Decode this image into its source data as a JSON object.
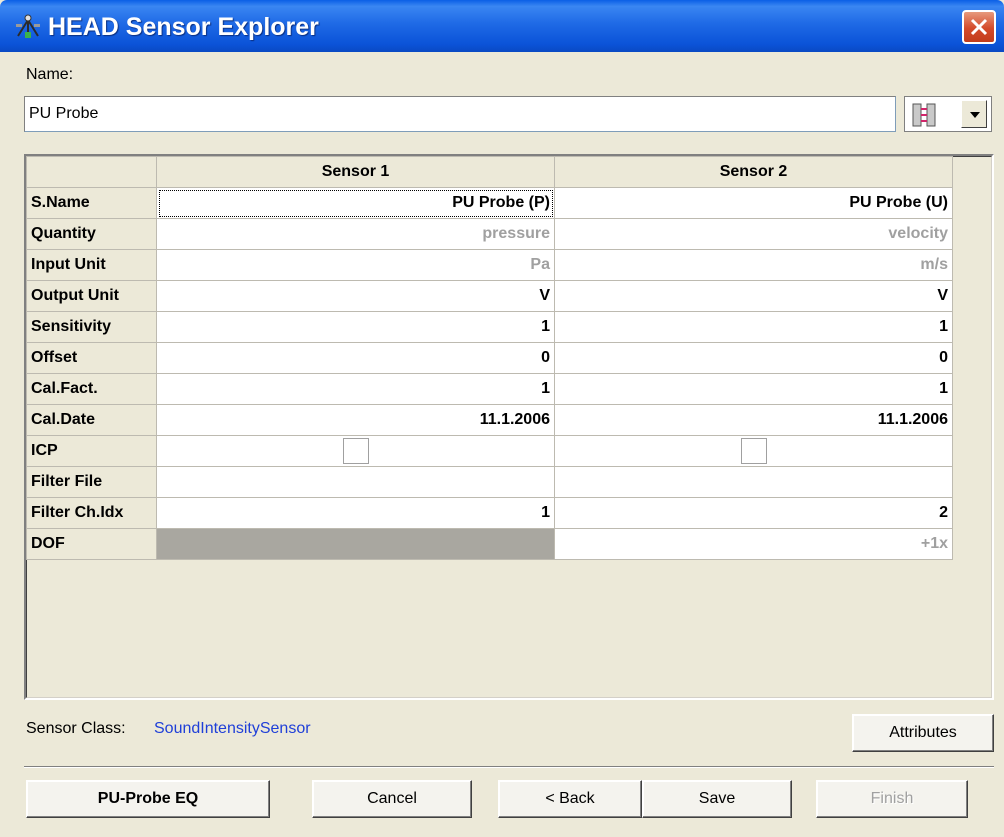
{
  "window": {
    "title": "HEAD Sensor Explorer"
  },
  "name_field": {
    "label": "Name:",
    "value": "PU Probe"
  },
  "grid": {
    "columns": [
      "Sensor 1",
      "Sensor 2"
    ],
    "rows": [
      {
        "label": "S.Name",
        "s1": "PU Probe (P)",
        "s2": "PU Probe (U)"
      },
      {
        "label": "Quantity",
        "s1": "pressure",
        "s2": "velocity"
      },
      {
        "label": "Input Unit",
        "s1": "Pa",
        "s2": "m/s"
      },
      {
        "label": "Output Unit",
        "s1": "V",
        "s2": "V"
      },
      {
        "label": "Sensitivity",
        "s1": "1",
        "s2": "1"
      },
      {
        "label": "Offset",
        "s1": "0",
        "s2": "0"
      },
      {
        "label": "Cal.Fact.",
        "s1": "1",
        "s2": "1"
      },
      {
        "label": "Cal.Date",
        "s1": "11.1.2006",
        "s2": "11.1.2006"
      },
      {
        "label": "ICP",
        "s1": "",
        "s2": ""
      },
      {
        "label": "Filter File",
        "s1": "",
        "s2": ""
      },
      {
        "label": "Filter Ch.Idx",
        "s1": "1",
        "s2": "2"
      },
      {
        "label": "DOF",
        "s1": "",
        "s2": "+1x"
      }
    ]
  },
  "sensor_class": {
    "label": "Sensor Class:",
    "value": "SoundIntensitySensor"
  },
  "buttons": {
    "attributes": "Attributes",
    "pu_probe_eq": "PU-Probe EQ",
    "cancel": "Cancel",
    "back": "< Back",
    "save": "Save",
    "finish": "Finish"
  },
  "colors": {
    "titlebar": "#0b53d8",
    "link": "#1f3fd8",
    "face": "#ece9d8"
  }
}
